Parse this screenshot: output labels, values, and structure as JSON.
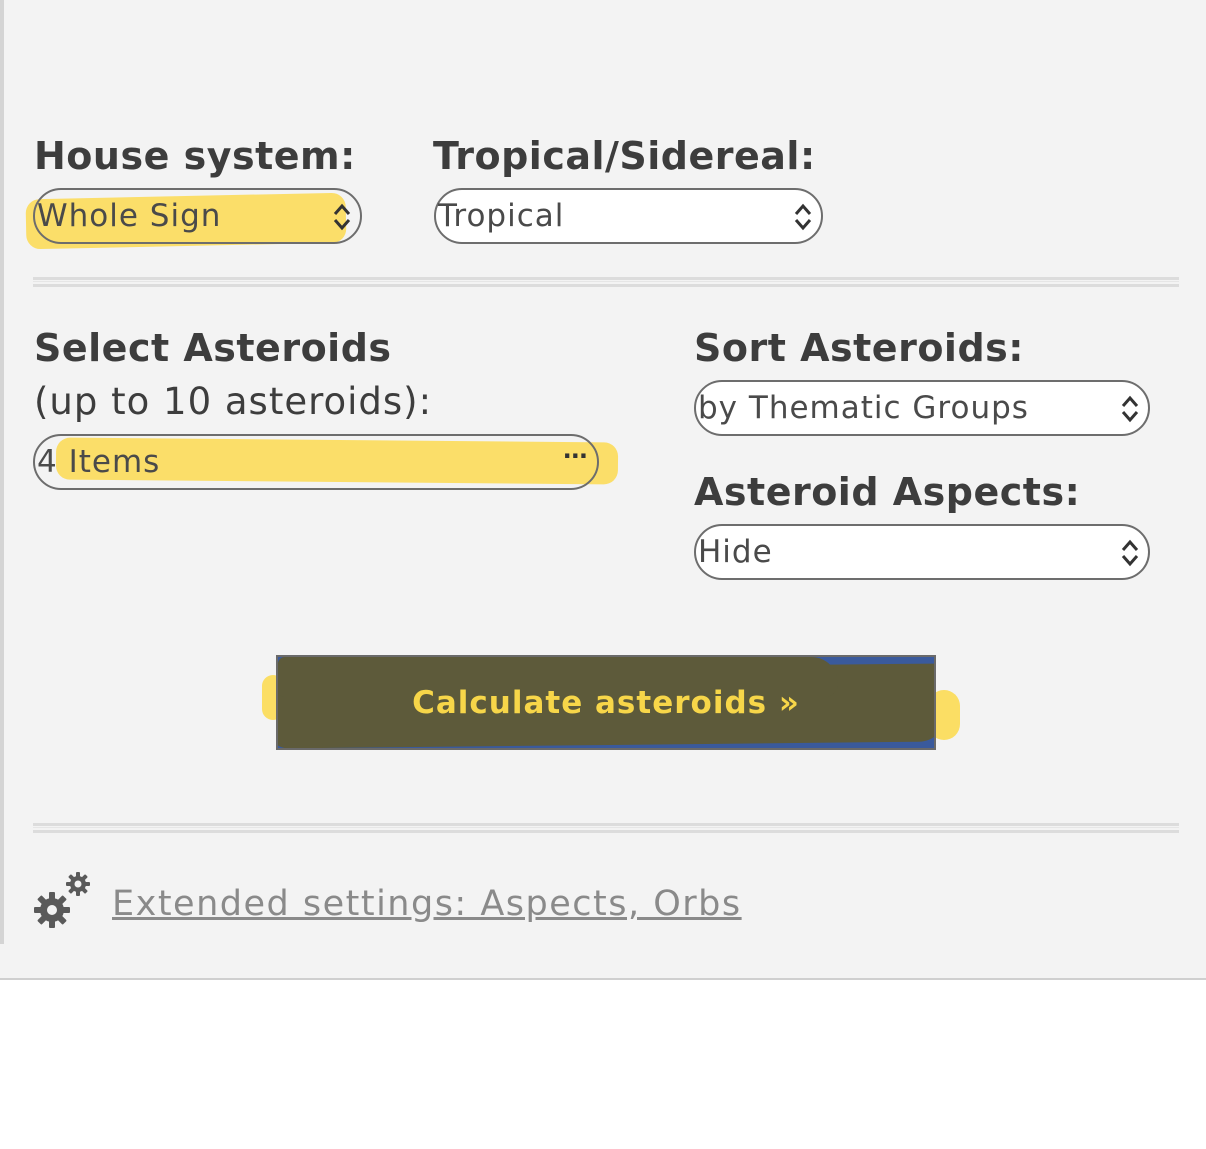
{
  "house_system": {
    "label": "House system:",
    "selected": "Whole Sign"
  },
  "tropical_sidereal": {
    "label": "Tropical/Sidereal:",
    "selected": "Tropical"
  },
  "select_asteroids": {
    "label": "Select Asteroids",
    "sublabel": "(up to 10 asteroids):",
    "selected": "4 Items",
    "more_icon": "ellipsis-icon"
  },
  "sort_asteroids": {
    "label": "Sort Asteroids:",
    "selected": "by Thematic Groups"
  },
  "asteroid_aspects": {
    "label": "Asteroid Aspects:",
    "selected": "Hide"
  },
  "calculate_button": {
    "label": "Calculate asteroids »"
  },
  "extended_settings": {
    "icon": "gears-icon",
    "link_text": "Extended settings: Aspects, Orbs"
  },
  "colors": {
    "highlight": "#fcd94a",
    "button_blue": "#3a5a9c",
    "button_text": "#f7d649",
    "panel_bg": "#f3f3f3"
  }
}
